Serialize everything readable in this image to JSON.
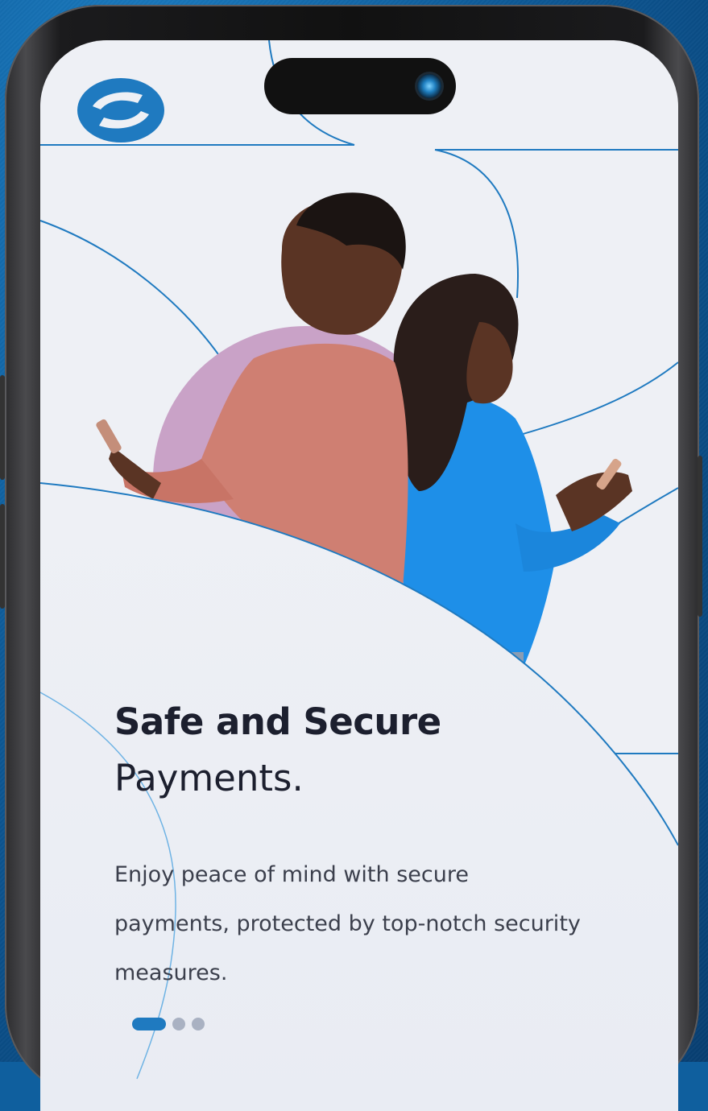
{
  "onboarding": {
    "title_bold": "Safe and Secure",
    "title_light": "Payments.",
    "description": "Enjoy peace of mind with secure payments, protected by top-notch security measures.",
    "pager": {
      "total": 3,
      "current": 1
    }
  },
  "colors": {
    "brand": "#1f7ac0",
    "accent_circle": "#c9a2c7",
    "title": "#1c1f2e",
    "body_text": "#3b3f4c",
    "screen_bg": "#eef0f5"
  },
  "icons": {
    "logo": "brand-s-logo-icon",
    "camera": "front-camera-icon"
  }
}
